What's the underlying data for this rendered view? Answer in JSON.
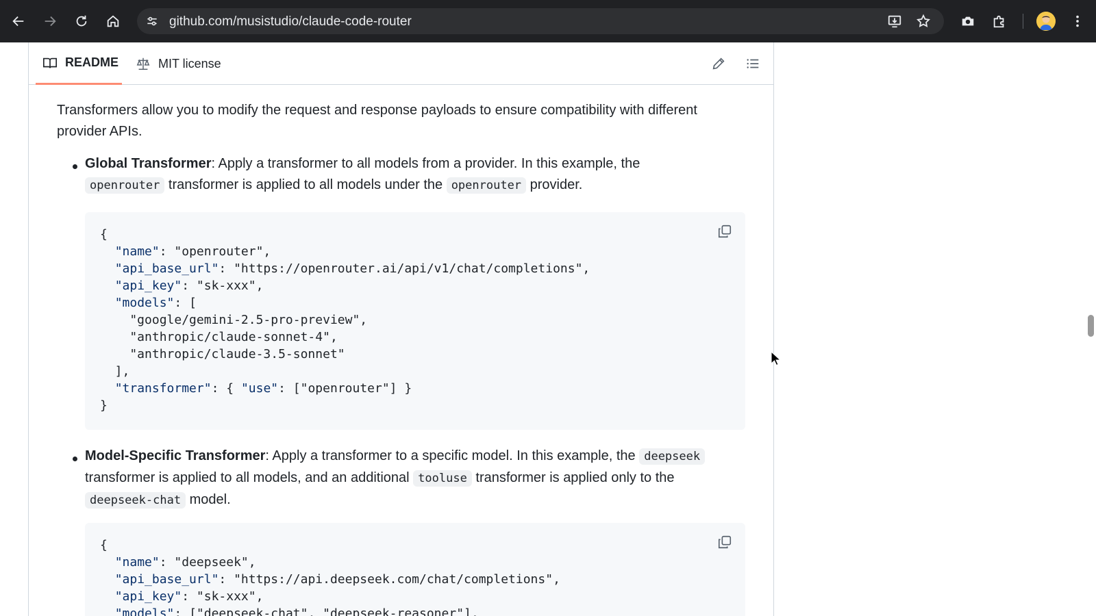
{
  "browser": {
    "url": "github.com/musistudio/claude-code-router",
    "back_icon": "arrow-left",
    "forward_icon": "arrow-right",
    "reload_icon": "reload",
    "home_icon": "home",
    "site_info_icon": "tune",
    "install_icon": "install-app",
    "bookmark_icon": "star",
    "camera_icon": "camera",
    "extensions_icon": "puzzle",
    "menu_icon": "kebab"
  },
  "readme": {
    "tabs": [
      {
        "label": "README",
        "icon": "book",
        "selected": true
      },
      {
        "label": "MIT license",
        "icon": "scale"
      }
    ],
    "edit_icon": "pencil",
    "outline_icon": "list"
  },
  "content": {
    "intro": "Transformers allow you to modify the request and response payloads to ensure compatibility with different provider APIs.",
    "global": {
      "title": "Global Transformer",
      "text1": ": Apply a transformer to all models from a provider. In this example, the",
      "code1": "openrouter",
      "text2": " transformer is applied to all models under the ",
      "code2": "openrouter",
      "text3": " provider."
    },
    "model_specific": {
      "title": "Model-Specific Transformer",
      "text1": ": Apply a transformer to a specific model. In this example, the ",
      "code1": "deepseek",
      "text2": "transformer is applied to all models, and an additional ",
      "code2": "tooluse",
      "text3": " transformer is applied only to the",
      "code3": "deepseek-chat",
      "text4": " model."
    },
    "code_block_1": [
      "{",
      "  \"name\": \"openrouter\",",
      "  \"api_base_url\": \"https://openrouter.ai/api/v1/chat/completions\",",
      "  \"api_key\": \"sk-xxx\",",
      "  \"models\": [",
      "    \"google/gemini-2.5-pro-preview\",",
      "    \"anthropic/claude-sonnet-4\",",
      "    \"anthropic/claude-3.5-sonnet\"",
      "  ],",
      "  \"transformer\": { \"use\": [\"openrouter\"] }",
      "}"
    ],
    "code_block_2": [
      "{",
      "  \"name\": \"deepseek\",",
      "  \"api_base_url\": \"https://api.deepseek.com/chat/completions\",",
      "  \"api_key\": \"sk-xxx\",",
      "  \"models\": [\"deepseek-chat\", \"deepseek-reasoner\"],"
    ],
    "copy_icon": "copy"
  }
}
